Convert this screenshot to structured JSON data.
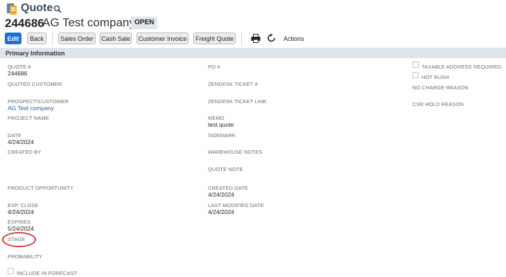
{
  "header": {
    "page_type": "Quote",
    "record_number": "244686",
    "record_name": "AG Test company",
    "status": "OPEN"
  },
  "toolbar": {
    "edit": "Edit",
    "back": "Back",
    "sales_order": "Sales Order",
    "cash_sale": "Cash Sale",
    "customer_invoice": "Customer Invoice",
    "freight_quote": "Freight Quote",
    "actions": "Actions"
  },
  "section": {
    "title": "Primary Information"
  },
  "fields": {
    "quote_no": {
      "label": "QUOTE #",
      "value": "244686"
    },
    "quoted_customer": {
      "label": "QUOTED CUSTOMER"
    },
    "prospect_customer": {
      "label": "PROSPECT/CUSTOMER",
      "value": "AG Test company"
    },
    "project_name": {
      "label": "PROJECT NAME"
    },
    "date": {
      "label": "DATE",
      "value": "4/24/2024"
    },
    "created_by": {
      "label": "CREATED BY"
    },
    "product_opportunity": {
      "label": "PRODUCT OPPORTUNITY"
    },
    "exp_close": {
      "label": "EXP. CLOSE",
      "value": "4/24/2024"
    },
    "expires": {
      "label": "EXPIRES",
      "value": "5/24/2024"
    },
    "stage": {
      "label": "STAGE"
    },
    "probability": {
      "label": "PROBABILITY"
    },
    "include_in_forecast": {
      "label": "INCLUDE IN FORECAST"
    },
    "po_no": {
      "label": "PO #"
    },
    "zendesk_ticket": {
      "label": "ZENDESK TICKET #"
    },
    "zendesk_ticket_link": {
      "label": "ZENDESK TICKET LINK"
    },
    "memo": {
      "label": "MEMO",
      "value": "test quote"
    },
    "sidemark": {
      "label": "SIDEMARK"
    },
    "warehouse_notes": {
      "label": "WAREHOUSE NOTES"
    },
    "quote_note": {
      "label": "QUOTE NOTE"
    },
    "created_date": {
      "label": "CREATED DATE",
      "value": "4/24/2024"
    },
    "last_modified_date": {
      "label": "LAST MODIFIED DATE",
      "value": "4/24/2024"
    },
    "taxable_address_required": {
      "label": "TAXABLE ADDRESS REQUIRED"
    },
    "hot_rush": {
      "label": "HOT RUSH"
    },
    "no_charge_reason": {
      "label": "NO CHARGE REASON"
    },
    "csr_hold_reason": {
      "label": "CSR HOLD REASON"
    }
  },
  "colors": {
    "accent": "#1d6fd6",
    "annotation": "#d93a3a",
    "section_bg": "#dfe4ea"
  },
  "icons": [
    "quote-icon",
    "search-icon",
    "print-icon",
    "refresh-icon"
  ]
}
